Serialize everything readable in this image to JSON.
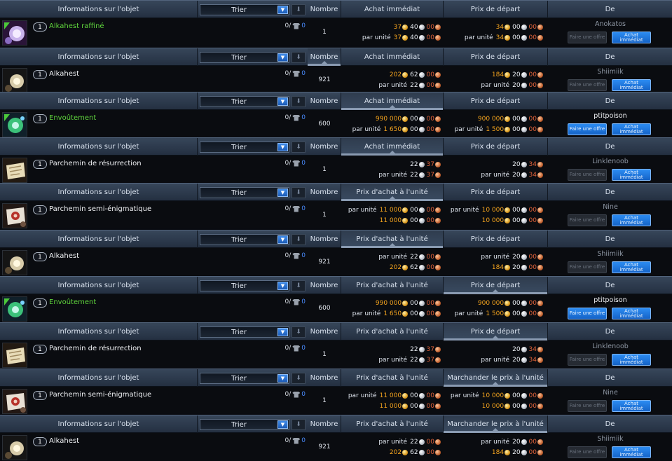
{
  "headers": {
    "info": "Informations sur l'objet",
    "sort": "Trier",
    "count": "Nombre",
    "from": "De"
  },
  "per_unit": "par unité",
  "buttons": {
    "offer": "Faire une offre",
    "buy": "Achat immédiat"
  },
  "blocks": [
    {
      "col3": "Achat immédiat",
      "col4": "Prix de départ",
      "active": "none",
      "item": {
        "qty": "1",
        "name": "Alkahest raffiné",
        "green": true,
        "icon": "alkahest-refined-icon",
        "stock": "0/",
        "stock_count": "0",
        "count": "1",
        "seller": "Anokatos",
        "seller_hi": false,
        "offer_enabled": false,
        "c3": [
          {
            "label": "",
            "p": [
              [
                "g",
                "37"
              ],
              [
                "w",
                "40"
              ],
              [
                "c",
                "00"
              ]
            ]
          },
          {
            "label": "par unité",
            "p": [
              [
                "g",
                "37"
              ],
              [
                "w",
                "40"
              ],
              [
                "c",
                "00"
              ]
            ]
          }
        ],
        "c4": [
          {
            "label": "",
            "p": [
              [
                "g",
                "34"
              ],
              [
                "w",
                "00"
              ],
              [
                "c",
                "00"
              ]
            ]
          },
          {
            "label": "par unité",
            "p": [
              [
                "g",
                "34"
              ],
              [
                "w",
                "00"
              ],
              [
                "c",
                "00"
              ]
            ]
          }
        ]
      }
    },
    {
      "col3": "Achat immédiat",
      "col4": "Prix de départ",
      "active": "count",
      "item": {
        "qty": "1",
        "name": "Alkahest",
        "green": false,
        "icon": "alkahest-icon",
        "stock": "0/",
        "stock_count": "0",
        "count": "921",
        "seller": "Shiimiik",
        "seller_hi": false,
        "offer_enabled": false,
        "c3": [
          {
            "label": "",
            "p": [
              [
                "g",
                "202"
              ],
              [
                "w",
                "62"
              ],
              [
                "c",
                "00"
              ]
            ]
          },
          {
            "label": "par unité",
            "p": [
              [
                "w",
                "22"
              ],
              [
                "c",
                "00"
              ]
            ]
          }
        ],
        "c4": [
          {
            "label": "",
            "p": [
              [
                "g",
                "184"
              ],
              [
                "w",
                "20"
              ],
              [
                "c",
                "00"
              ]
            ]
          },
          {
            "label": "par unité",
            "p": [
              [
                "w",
                "20"
              ],
              [
                "c",
                "00"
              ]
            ]
          }
        ]
      }
    },
    {
      "col3": "Achat immédiat",
      "col4": "Prix de départ",
      "active": "col3",
      "item": {
        "qty": "1",
        "name": "Envoûtement",
        "green": true,
        "icon": "enchantment-icon",
        "stock": "0/",
        "stock_count": "0",
        "count": "600",
        "seller": "ptitpoison",
        "seller_hi": true,
        "offer_enabled": true,
        "c3": [
          {
            "label": "",
            "p": [
              [
                "g",
                "990 000"
              ],
              [
                "w",
                "00"
              ],
              [
                "c",
                "00"
              ]
            ]
          },
          {
            "label": "par unité",
            "p": [
              [
                "g",
                "1 650"
              ],
              [
                "w",
                "00"
              ],
              [
                "c",
                "00"
              ]
            ]
          }
        ],
        "c4": [
          {
            "label": "",
            "p": [
              [
                "g",
                "900 000"
              ],
              [
                "w",
                "00"
              ],
              [
                "c",
                "00"
              ]
            ]
          },
          {
            "label": "par unité",
            "p": [
              [
                "g",
                "1 500"
              ],
              [
                "w",
                "00"
              ],
              [
                "c",
                "00"
              ]
            ]
          }
        ]
      }
    },
    {
      "col3": "Achat immédiat",
      "col4": "Prix de départ",
      "active": "col3",
      "item": {
        "qty": "1",
        "name": "Parchemin de résurrection",
        "green": false,
        "icon": "resurrection-scroll-icon",
        "stock": "0/",
        "stock_count": "0",
        "count": "1",
        "seller": "Linklenoob",
        "seller_hi": false,
        "offer_enabled": false,
        "c3": [
          {
            "label": "",
            "p": [
              [
                "w",
                "22"
              ],
              [
                "c",
                "37"
              ]
            ]
          },
          {
            "label": "par unité",
            "p": [
              [
                "w",
                "22"
              ],
              [
                "c",
                "37"
              ]
            ]
          }
        ],
        "c4": [
          {
            "label": "",
            "p": [
              [
                "w",
                "20"
              ],
              [
                "c",
                "34"
              ]
            ]
          },
          {
            "label": "par unité",
            "p": [
              [
                "w",
                "20"
              ],
              [
                "c",
                "34"
              ]
            ]
          }
        ]
      }
    },
    {
      "col3": "Prix d'achat à l'unité",
      "col4": "Prix de départ",
      "active": "col3",
      "item": {
        "qty": "1",
        "name": "Parchemin semi-énigmatique",
        "green": false,
        "icon": "semi-enigmatic-scroll-icon",
        "stock": "0/",
        "stock_count": "0",
        "count": "1",
        "seller": "Nine",
        "seller_hi": false,
        "offer_enabled": false,
        "c3": [
          {
            "label": "par unité",
            "p": [
              [
                "g",
                "11 000"
              ],
              [
                "w",
                "00"
              ],
              [
                "c",
                "00"
              ]
            ]
          },
          {
            "label": "",
            "p": [
              [
                "g",
                "11 000"
              ],
              [
                "w",
                "00"
              ],
              [
                "c",
                "00"
              ]
            ]
          }
        ],
        "c4": [
          {
            "label": "par unité",
            "p": [
              [
                "g",
                "10 000"
              ],
              [
                "w",
                "00"
              ],
              [
                "c",
                "00"
              ]
            ]
          },
          {
            "label": "",
            "p": [
              [
                "g",
                "10 000"
              ],
              [
                "w",
                "00"
              ],
              [
                "c",
                "00"
              ]
            ]
          }
        ]
      }
    },
    {
      "col3": "Prix d'achat à l'unité",
      "col4": "Prix de départ",
      "active": "col3",
      "item": {
        "qty": "1",
        "name": "Alkahest",
        "green": false,
        "icon": "alkahest-icon",
        "stock": "0/",
        "stock_count": "0",
        "count": "921",
        "seller": "Shiimiik",
        "seller_hi": false,
        "offer_enabled": false,
        "c3": [
          {
            "label": "par unité",
            "p": [
              [
                "w",
                "22"
              ],
              [
                "c",
                "00"
              ]
            ]
          },
          {
            "label": "",
            "p": [
              [
                "g",
                "202"
              ],
              [
                "w",
                "62"
              ],
              [
                "c",
                "00"
              ]
            ]
          }
        ],
        "c4": [
          {
            "label": "par unité",
            "p": [
              [
                "w",
                "20"
              ],
              [
                "c",
                "00"
              ]
            ]
          },
          {
            "label": "",
            "p": [
              [
                "g",
                "184"
              ],
              [
                "w",
                "20"
              ],
              [
                "c",
                "00"
              ]
            ]
          }
        ]
      }
    },
    {
      "col3": "Prix d'achat à l'unité",
      "col4": "Prix de départ",
      "active": "col4",
      "item": {
        "qty": "1",
        "name": "Envoûtement",
        "green": true,
        "icon": "enchantment-icon",
        "stock": "0/",
        "stock_count": "0",
        "count": "600",
        "seller": "ptitpoison",
        "seller_hi": true,
        "offer_enabled": true,
        "c3": [
          {
            "label": "",
            "p": [
              [
                "g",
                "990 000"
              ],
              [
                "w",
                "00"
              ],
              [
                "c",
                "00"
              ]
            ]
          },
          {
            "label": "par unité",
            "p": [
              [
                "g",
                "1 650"
              ],
              [
                "w",
                "00"
              ],
              [
                "c",
                "00"
              ]
            ]
          }
        ],
        "c4": [
          {
            "label": "",
            "p": [
              [
                "g",
                "900 000"
              ],
              [
                "w",
                "00"
              ],
              [
                "c",
                "00"
              ]
            ]
          },
          {
            "label": "par unité",
            "p": [
              [
                "g",
                "1 500"
              ],
              [
                "w",
                "00"
              ],
              [
                "c",
                "00"
              ]
            ]
          }
        ]
      }
    },
    {
      "col3": "Prix d'achat à l'unité",
      "col4": "Prix de départ",
      "active": "col4",
      "item": {
        "qty": "1",
        "name": "Parchemin de résurrection",
        "green": false,
        "icon": "resurrection-scroll-icon",
        "stock": "0/",
        "stock_count": "0",
        "count": "1",
        "seller": "Linklenoob",
        "seller_hi": false,
        "offer_enabled": false,
        "c3": [
          {
            "label": "",
            "p": [
              [
                "w",
                "22"
              ],
              [
                "c",
                "37"
              ]
            ]
          },
          {
            "label": "par unité",
            "p": [
              [
                "w",
                "22"
              ],
              [
                "c",
                "37"
              ]
            ]
          }
        ],
        "c4": [
          {
            "label": "",
            "p": [
              [
                "w",
                "20"
              ],
              [
                "c",
                "34"
              ]
            ]
          },
          {
            "label": "par unité",
            "p": [
              [
                "w",
                "20"
              ],
              [
                "c",
                "34"
              ]
            ]
          }
        ]
      }
    },
    {
      "col3": "Prix d'achat à l'unité",
      "col4": "Marchander le prix à l'unité",
      "active": "col4",
      "item": {
        "qty": "1",
        "name": "Parchemin semi-énigmatique",
        "green": false,
        "icon": "semi-enigmatic-scroll-icon",
        "stock": "0/",
        "stock_count": "0",
        "count": "1",
        "seller": "Nine",
        "seller_hi": false,
        "offer_enabled": false,
        "c3": [
          {
            "label": "par unité",
            "p": [
              [
                "g",
                "11 000"
              ],
              [
                "w",
                "00"
              ],
              [
                "c",
                "00"
              ]
            ]
          },
          {
            "label": "",
            "p": [
              [
                "g",
                "11 000"
              ],
              [
                "w",
                "00"
              ],
              [
                "c",
                "00"
              ]
            ]
          }
        ],
        "c4": [
          {
            "label": "par unité",
            "p": [
              [
                "g",
                "10 000"
              ],
              [
                "w",
                "00"
              ],
              [
                "c",
                "00"
              ]
            ]
          },
          {
            "label": "",
            "p": [
              [
                "g",
                "10 000"
              ],
              [
                "w",
                "00"
              ],
              [
                "c",
                "00"
              ]
            ]
          }
        ]
      }
    },
    {
      "col3": "Prix d'achat à l'unité",
      "col4": "Marchander le prix à l'unité",
      "active": "col4",
      "item": {
        "qty": "1",
        "name": "Alkahest",
        "green": false,
        "icon": "alkahest-icon",
        "stock": "0/",
        "stock_count": "0",
        "count": "921",
        "seller": "Shiimiik",
        "seller_hi": false,
        "offer_enabled": false,
        "c3": [
          {
            "label": "par unité",
            "p": [
              [
                "w",
                "22"
              ],
              [
                "c",
                "00"
              ]
            ]
          },
          {
            "label": "",
            "p": [
              [
                "g",
                "202"
              ],
              [
                "w",
                "62"
              ],
              [
                "c",
                "00"
              ]
            ]
          }
        ],
        "c4": [
          {
            "label": "par unité",
            "p": [
              [
                "w",
                "20"
              ],
              [
                "c",
                "00"
              ]
            ]
          },
          {
            "label": "",
            "p": [
              [
                "g",
                "184"
              ],
              [
                "w",
                "20"
              ],
              [
                "c",
                "00"
              ]
            ]
          }
        ]
      }
    }
  ]
}
